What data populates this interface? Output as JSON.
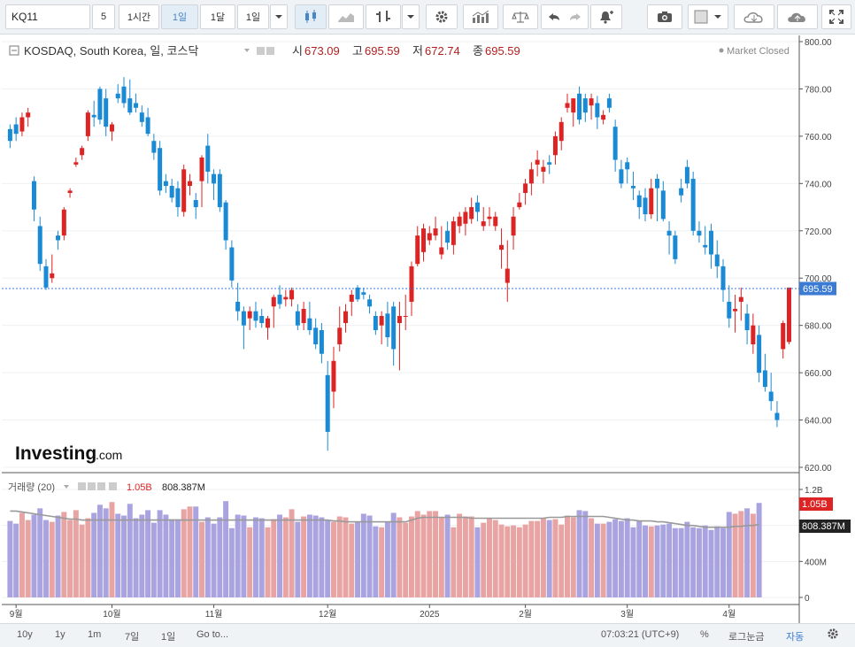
{
  "toolbar": {
    "symbol": "KQ11",
    "interval_value": "5",
    "btn_1h": "1시간",
    "btn_1d": "1일",
    "btn_1mo": "1달",
    "btn_1d_alt": "1일"
  },
  "legend": {
    "name": "KOSDAQ, South Korea, 일, 코스닥",
    "open_label": "시",
    "open": "673.09",
    "high_label": "고",
    "high": "695.59",
    "low_label": "저",
    "low": "672.74",
    "close_label": "종",
    "close": "695.59",
    "status": "Market Closed"
  },
  "volume_legend": {
    "name": "거래량 (20)",
    "value": "1.05B",
    "ma_value": "808.387M"
  },
  "watermark": {
    "brand": "Investing",
    "suffix": ".com"
  },
  "price_axis": {
    "ticks": [
      "800.00",
      "780.00",
      "760.00",
      "740.00",
      "720.00",
      "700.00",
      "680.00",
      "660.00",
      "640.00",
      "620.00"
    ],
    "last_label": "695.59"
  },
  "volume_axis": {
    "ticks": [
      "1.2B",
      "800M",
      "400M",
      "0"
    ],
    "last_label": "1.05B",
    "ma_label": "808.387M"
  },
  "time_axis": {
    "labels": [
      "9월",
      "10월",
      "11월",
      "12월",
      "2025",
      "2월",
      "3월",
      "4월"
    ]
  },
  "bottombar": {
    "ranges": [
      "10y",
      "1y",
      "1m",
      "7일",
      "1일"
    ],
    "goto": "Go to...",
    "time": "07:03:21 (UTC+9)",
    "percent": "%",
    "log": "로그눈금",
    "auto": "자동"
  },
  "colors": {
    "up": "#dd2424",
    "down": "#1a8ad4",
    "up_vol": "#e8a3a3",
    "down_vol": "#a9a3e0",
    "ma": "#999999",
    "last_price": "#3b7bd4"
  },
  "chart_data": [
    {
      "type": "candlestick",
      "title": "KOSDAQ, South Korea, 일, 코스닥",
      "x_label_months": [
        "9월",
        "10월",
        "11월",
        "12월",
        "2025",
        "2월",
        "3월",
        "4월"
      ],
      "ylim": [
        620,
        805
      ],
      "y_ticks": [
        800,
        780,
        760,
        740,
        720,
        700,
        680,
        660,
        640,
        620
      ],
      "last_price": 695.59,
      "ohlc": [
        [
          763,
          765,
          755,
          758
        ],
        [
          765,
          768,
          758,
          761
        ],
        [
          762,
          770,
          760,
          768
        ],
        [
          768,
          772,
          764,
          770
        ],
        [
          741,
          743,
          724,
          729
        ],
        [
          722,
          726,
          703,
          706
        ],
        [
          705,
          708,
          695,
          696
        ],
        [
          700,
          710,
          698,
          702
        ],
        [
          718,
          720,
          712,
          716
        ],
        [
          718,
          730,
          716,
          729
        ],
        [
          736,
          738,
          734,
          737
        ],
        [
          748,
          751,
          747,
          749
        ],
        [
          752,
          756,
          750,
          755
        ],
        [
          760,
          771,
          758,
          770
        ],
        [
          769,
          775,
          764,
          768
        ],
        [
          780,
          781,
          765,
          767
        ],
        [
          776,
          780,
          760,
          764
        ],
        [
          762,
          766,
          758,
          765
        ],
        [
          778,
          782,
          774,
          776
        ],
        [
          781,
          785,
          772,
          774
        ],
        [
          776,
          784,
          769,
          770
        ],
        [
          774,
          778,
          770,
          772
        ],
        [
          770,
          773,
          764,
          766
        ],
        [
          768,
          772,
          760,
          761
        ],
        [
          758,
          761,
          750,
          753
        ],
        [
          755,
          758,
          735,
          737
        ],
        [
          741,
          744,
          736,
          739
        ],
        [
          739,
          742,
          732,
          734
        ],
        [
          738,
          741,
          726,
          730
        ],
        [
          728,
          748,
          726,
          746
        ],
        [
          739,
          744,
          735,
          741
        ],
        [
          733,
          736,
          725,
          730
        ],
        [
          741,
          752,
          730,
          751
        ],
        [
          756,
          761,
          740,
          745
        ],
        [
          744,
          746,
          733,
          740
        ],
        [
          744,
          746,
          728,
          730
        ],
        [
          732,
          733,
          712,
          716
        ],
        [
          713,
          716,
          696,
          699
        ],
        [
          690,
          698,
          682,
          686
        ],
        [
          686,
          688,
          670,
          680
        ],
        [
          683,
          688,
          678,
          686
        ],
        [
          686,
          690,
          679,
          682
        ],
        [
          684,
          687,
          679,
          681
        ],
        [
          679,
          684,
          674,
          683
        ],
        [
          688,
          693,
          679,
          692
        ],
        [
          693,
          697,
          687,
          689
        ],
        [
          691,
          695,
          688,
          692
        ],
        [
          691,
          696,
          688,
          695
        ],
        [
          686,
          689,
          678,
          680
        ],
        [
          681,
          690,
          678,
          687
        ],
        [
          683,
          690,
          676,
          678
        ],
        [
          679,
          683,
          670,
          672
        ],
        [
          678,
          681,
          664,
          668
        ],
        [
          659,
          665,
          627,
          635
        ],
        [
          652,
          671,
          645,
          665
        ],
        [
          672,
          688,
          669,
          679
        ],
        [
          681,
          689,
          677,
          686
        ],
        [
          690,
          695,
          684,
          693
        ],
        [
          696,
          697,
          690,
          691
        ],
        [
          694,
          696,
          691,
          693
        ],
        [
          691,
          693,
          685,
          688
        ],
        [
          684,
          686,
          676,
          678
        ],
        [
          680,
          686,
          672,
          684
        ],
        [
          685,
          690,
          671,
          675
        ],
        [
          688,
          690,
          663,
          670
        ],
        [
          681,
          690,
          661,
          684
        ],
        [
          684,
          693,
          678,
          684
        ],
        [
          690,
          707,
          684,
          705
        ],
        [
          706,
          722,
          705,
          718
        ],
        [
          711,
          723,
          707,
          721
        ],
        [
          716,
          722,
          714,
          719
        ],
        [
          718,
          726,
          716,
          721
        ],
        [
          710,
          722,
          708,
          713
        ],
        [
          720,
          724,
          712,
          715
        ],
        [
          714,
          726,
          710,
          724
        ],
        [
          722,
          728,
          719,
          726
        ],
        [
          723,
          730,
          718,
          728
        ],
        [
          725,
          734,
          723,
          730
        ],
        [
          732,
          735,
          724,
          728
        ],
        [
          722,
          730,
          720,
          724
        ],
        [
          725,
          730,
          722,
          726
        ],
        [
          722,
          728,
          720,
          726
        ],
        [
          712,
          721,
          704,
          714
        ],
        [
          698,
          716,
          690,
          704
        ],
        [
          718,
          730,
          712,
          726
        ],
        [
          730,
          736,
          729,
          732
        ],
        [
          736,
          742,
          731,
          740
        ],
        [
          740,
          749,
          735,
          746
        ],
        [
          748,
          754,
          743,
          750
        ],
        [
          745,
          750,
          740,
          747
        ],
        [
          749,
          752,
          744,
          748
        ],
        [
          752,
          762,
          748,
          760
        ],
        [
          758,
          768,
          754,
          766
        ],
        [
          772,
          778,
          770,
          774
        ],
        [
          770,
          776,
          764,
          776
        ],
        [
          778,
          781,
          765,
          767
        ],
        [
          776,
          778,
          766,
          770
        ],
        [
          773,
          778,
          767,
          776
        ],
        [
          774,
          777,
          763,
          768
        ],
        [
          767,
          771,
          765,
          769
        ],
        [
          776,
          778,
          770,
          772
        ],
        [
          764,
          767,
          745,
          750
        ],
        [
          746,
          750,
          738,
          740
        ],
        [
          749,
          751,
          740,
          746
        ],
        [
          739,
          745,
          733,
          738
        ],
        [
          735,
          737,
          725,
          730
        ],
        [
          734,
          738,
          724,
          727
        ],
        [
          727,
          742,
          725,
          738
        ],
        [
          742,
          744,
          724,
          738
        ],
        [
          737,
          741,
          724,
          725
        ],
        [
          720,
          724,
          710,
          718
        ],
        [
          718,
          720,
          706,
          708
        ],
        [
          738,
          742,
          732,
          735
        ],
        [
          747,
          750,
          738,
          740
        ],
        [
          742,
          745,
          718,
          720
        ],
        [
          720,
          724,
          715,
          718
        ],
        [
          714,
          722,
          710,
          713
        ],
        [
          720,
          723,
          704,
          710
        ],
        [
          710,
          716,
          700,
          705
        ],
        [
          705,
          708,
          690,
          695
        ],
        [
          690,
          697,
          679,
          683
        ],
        [
          686,
          693,
          677,
          687
        ],
        [
          690,
          696,
          682,
          692
        ],
        [
          685,
          689,
          672,
          678
        ],
        [
          672,
          685,
          668,
          680
        ],
        [
          676,
          680,
          656,
          660
        ],
        [
          661,
          668,
          652,
          654
        ],
        [
          652,
          660,
          644,
          648
        ],
        [
          643,
          648,
          637,
          640
        ],
        [
          670,
          682,
          666,
          681
        ],
        [
          673,
          696,
          672,
          696
        ]
      ]
    },
    {
      "type": "bar",
      "title": "거래량 (20)",
      "ylim": [
        0,
        1.3
      ],
      "y_unit": "B",
      "y_ticks": [
        "1.2B",
        "800M",
        "400M",
        "0"
      ],
      "values": [
        0.85,
        0.82,
        0.94,
        0.86,
        0.92,
        0.99,
        0.86,
        0.84,
        0.91,
        0.95,
        0.86,
        0.97,
        0.81,
        0.88,
        0.94,
        1.03,
        0.99,
        1.06,
        0.93,
        0.91,
        1.04,
        0.88,
        0.92,
        0.97,
        0.83,
        0.97,
        0.92,
        0.87,
        0.87,
        0.98,
        1.01,
        1.01,
        0.84,
        0.89,
        0.82,
        0.89,
        1.07,
        0.77,
        0.92,
        0.91,
        0.78,
        0.89,
        0.88,
        0.78,
        0.87,
        0.92,
        0.89,
        0.98,
        0.84,
        0.9,
        0.92,
        0.91,
        0.89,
        0.86,
        0.84,
        0.9,
        0.89,
        0.82,
        0.84,
        0.93,
        0.91,
        0.79,
        0.78,
        0.84,
        0.94,
        0.89,
        0.83,
        0.9,
        0.96,
        0.92,
        0.96,
        0.96,
        0.89,
        0.92,
        0.78,
        0.93,
        0.9,
        0.9,
        0.78,
        0.83,
        0.88,
        0.86,
        0.81,
        0.79,
        0.8,
        0.78,
        0.81,
        0.85,
        0.85,
        0.88,
        0.86,
        0.87,
        0.81,
        0.91,
        0.89,
        0.97,
        0.96,
        0.88,
        0.82,
        0.82,
        0.84,
        0.87,
        0.85,
        0.88,
        0.78,
        0.85,
        0.8,
        0.79,
        0.8,
        0.81,
        0.82,
        0.77,
        0.77,
        0.84,
        0.78,
        0.77,
        0.8,
        0.75,
        0.79,
        0.77,
        0.95,
        0.93,
        0.96,
        0.99,
        0.93,
        1.05
      ],
      "ma": [
        0.96,
        0.96,
        0.95,
        0.94,
        0.93,
        0.92,
        0.91,
        0.9,
        0.89,
        0.88,
        0.87,
        0.87,
        0.86,
        0.86,
        0.86,
        0.86,
        0.86,
        0.86,
        0.86,
        0.86,
        0.86,
        0.86,
        0.86,
        0.86,
        0.86,
        0.86,
        0.86,
        0.86,
        0.86,
        0.86,
        0.86,
        0.86,
        0.86,
        0.86,
        0.86,
        0.86,
        0.86,
        0.86,
        0.86,
        0.86,
        0.86,
        0.86,
        0.86,
        0.86,
        0.86,
        0.86,
        0.86,
        0.86,
        0.86,
        0.86,
        0.86,
        0.86,
        0.86,
        0.86,
        0.85,
        0.85,
        0.84,
        0.84,
        0.84,
        0.84,
        0.84,
        0.84,
        0.84,
        0.84,
        0.84,
        0.84,
        0.84,
        0.86,
        0.88,
        0.89,
        0.89,
        0.89,
        0.89,
        0.89,
        0.89,
        0.89,
        0.89,
        0.88,
        0.88,
        0.88,
        0.88,
        0.88,
        0.88,
        0.88,
        0.88,
        0.88,
        0.88,
        0.88,
        0.88,
        0.88,
        0.89,
        0.89,
        0.89,
        0.9,
        0.9,
        0.9,
        0.9,
        0.9,
        0.9,
        0.9,
        0.89,
        0.88,
        0.87,
        0.86,
        0.86,
        0.85,
        0.85,
        0.85,
        0.84,
        0.84,
        0.83,
        0.82,
        0.81,
        0.8,
        0.8,
        0.79,
        0.78,
        0.78,
        0.78,
        0.78,
        0.78,
        0.79,
        0.79,
        0.8,
        0.8,
        0.81
      ]
    }
  ]
}
